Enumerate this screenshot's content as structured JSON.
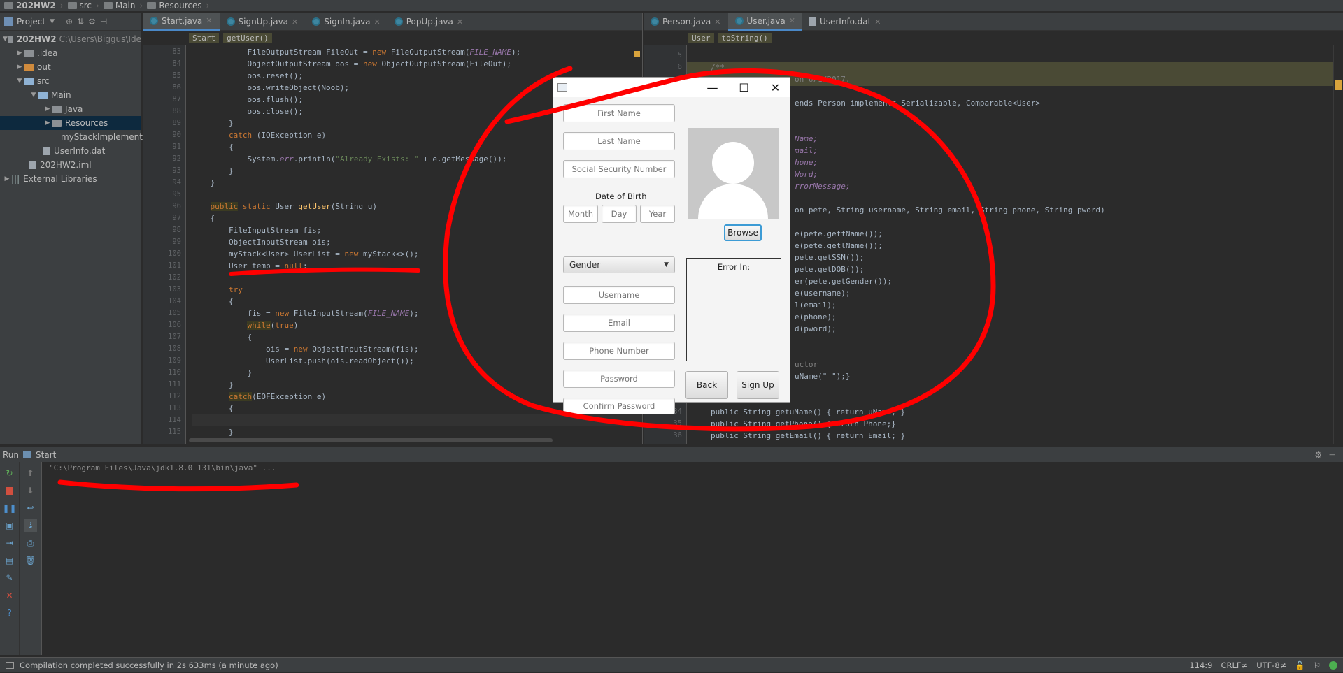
{
  "navbar": {
    "crumbs": [
      "202HW2",
      "src",
      "Main",
      "Resources"
    ]
  },
  "project": {
    "panel_label": "Project",
    "tree": [
      {
        "label": "202HW2",
        "sub": "C:\\Users\\Biggus\\Ide"
      },
      {
        "label": ".idea"
      },
      {
        "label": "out"
      },
      {
        "label": "src"
      },
      {
        "label": "Main"
      },
      {
        "label": "Java"
      },
      {
        "label": "Resources"
      },
      {
        "label": "myStackImplement"
      },
      {
        "label": "UserInfo.dat"
      },
      {
        "label": "202HW2.iml"
      },
      {
        "label": "External Libraries"
      }
    ]
  },
  "left_editor": {
    "tabs": [
      "Start.java",
      "SignUp.java",
      "SignIn.java",
      "PopUp.java"
    ],
    "crumbs": [
      "Start",
      "getUser()"
    ],
    "line_numbers": [
      "83",
      "84",
      "85",
      "86",
      "87",
      "88",
      "89",
      "90",
      "91",
      "92",
      "93",
      "94",
      "95",
      "96",
      "97",
      "98",
      "99",
      "100",
      "101",
      "102",
      "103",
      "104",
      "105",
      "106",
      "107",
      "108",
      "109",
      "110",
      "111",
      "112",
      "113",
      "114",
      "115"
    ]
  },
  "right_editor": {
    "tabs": [
      "Person.java",
      "User.java",
      "UserInfo.dat"
    ],
    "crumbs": [
      "User",
      "toString()"
    ],
    "line_numbers": [
      "5",
      "6",
      "",
      "",
      "",
      "",
      "",
      "",
      "",
      "",
      "",
      "",
      "",
      "",
      "",
      "",
      "",
      "",
      "",
      "",
      "",
      "",
      "",
      "",
      "",
      "",
      "",
      "",
      "",
      "",
      "34",
      "35",
      "36"
    ],
    "fragments": {
      "comment_open": "/**",
      "created_on": "on 6/1/2017.",
      "class_decl": "ends Person implements Serializable, Comparable<User>",
      "f1": "Name;",
      "f2": "mail;",
      "f3": "hone;",
      "f4": "Word;",
      "f5": "rrorMessage;",
      "ctor": "on pete, String username, String email, String phone, String pword)",
      "s1": "e(pete.getfName());",
      "s2": "e(pete.getlName());",
      "s3": "pete.getSSN());",
      "s4": "pete.getDOB());",
      "s5": "er(pete.getGender());",
      "s6": "e(username);",
      "s7": "l(email);",
      "s8": "e(phone);",
      "s9": "d(pword);",
      "s10": "uctor",
      "s11": "uName(\" \");}",
      "m1": "public String getuName() { return uName; }",
      "m2": "public String getPhone() {return Phone;}",
      "m3": "public String getEmail() { return Email; }"
    }
  },
  "run": {
    "label": "Run",
    "config": "Start",
    "console": "\"C:\\Program Files\\Java\\jdk1.8.0_131\\bin\\java\" ..."
  },
  "status": {
    "message": "Compilation completed successfully in 2s 633ms (a minute ago)",
    "position": "114:9",
    "line_sep": "CRLF≠",
    "encoding": "UTF-8≠"
  },
  "dialog": {
    "first_name_placeholder": "First Name",
    "last_name_placeholder": "Last Name",
    "ssn_placeholder": "Social Security Number",
    "dob_label": "Date of Birth",
    "month_placeholder": "Month",
    "day_placeholder": "Day",
    "year_placeholder": "Year",
    "gender_value": "Gender",
    "username_placeholder": "Username",
    "email_placeholder": "Email",
    "phone_placeholder": "Phone Number",
    "password_placeholder": "Password",
    "confirm_placeholder": "Confirm Password",
    "browse_label": "Browse",
    "error_label": "Error In:",
    "back_label": "Back",
    "signup_label": "Sign Up"
  },
  "colors": {
    "annotation_red": "#ff0000",
    "accent_tab": "#4a88c7"
  }
}
